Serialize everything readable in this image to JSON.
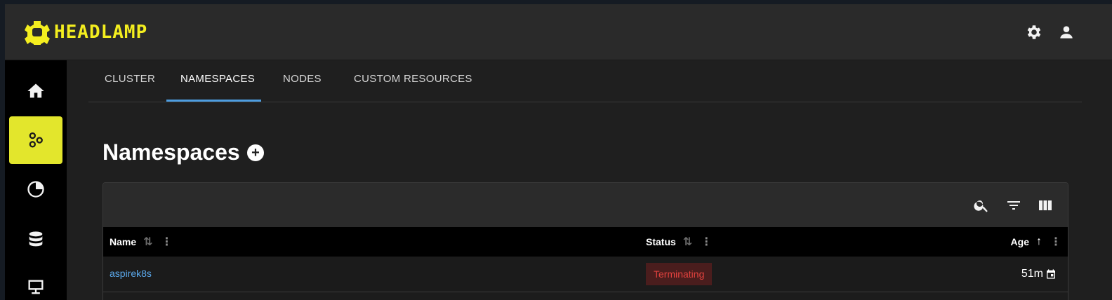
{
  "app": {
    "logo_text": "HEADLAMP",
    "brand_color": "#f4ee1f"
  },
  "topbar": {
    "icons": [
      "gear-icon",
      "account-icon"
    ]
  },
  "sidebar": {
    "items": [
      {
        "name": "home",
        "icon": "home-icon",
        "active": false
      },
      {
        "name": "cluster",
        "icon": "hexagons-icon",
        "active": true
      },
      {
        "name": "insights",
        "icon": "pie-chart-icon",
        "active": false
      },
      {
        "name": "storage",
        "icon": "database-icon",
        "active": false
      },
      {
        "name": "network",
        "icon": "lan-icon",
        "active": false
      }
    ],
    "active_color": "#e3e62c"
  },
  "tabs": [
    {
      "label": "CLUSTER",
      "active": false
    },
    {
      "label": "NAMESPACES",
      "active": true
    },
    {
      "label": "NODES",
      "active": false
    },
    {
      "label": "CUSTOM RESOURCES",
      "active": false
    }
  ],
  "page": {
    "title": "Namespaces",
    "add_label": "+"
  },
  "table": {
    "toolbar_icons": [
      "search-icon",
      "filter-icon",
      "columns-icon"
    ],
    "columns": [
      {
        "label": "Name",
        "sort_symbol": "⇅"
      },
      {
        "label": "Status",
        "sort_symbol": "⇅"
      },
      {
        "label": "Age",
        "sort_symbol": "↑"
      }
    ],
    "more_symbol": "⋮",
    "rows": [
      {
        "name": "aspirek8s",
        "status": "Terminating",
        "age": "51m"
      }
    ]
  }
}
